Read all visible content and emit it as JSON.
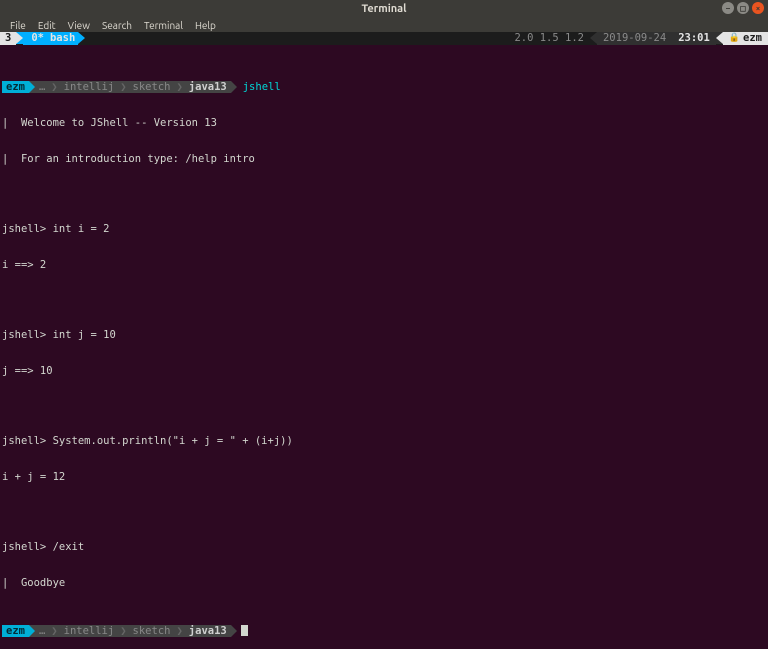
{
  "window": {
    "title": "Terminal"
  },
  "menubar": {
    "file": "File",
    "edit": "Edit",
    "view": "View",
    "search": "Search",
    "terminal": "Terminal",
    "help": "Help"
  },
  "tmux": {
    "session": "3",
    "window_index": "0*",
    "window_name": "bash",
    "load": "2.0 1.5 1.2",
    "date": "2019-09-24",
    "time": "23:01",
    "host": "ezm"
  },
  "prompt1": {
    "user": "ezm",
    "dots": "…",
    "p1": "intellij",
    "p2": "sketch",
    "p3": "java13",
    "cmd": "jshell"
  },
  "session": {
    "welcome1": "|  Welcome to JShell -- Version 13",
    "welcome2": "|  For an introduction type: /help intro",
    "l1": "jshell> int i = 2",
    "l2": "i ==> 2",
    "l3": "jshell> int j = 10",
    "l4": "j ==> 10",
    "l5": "jshell> System.out.println(\"i + j = \" + (i+j))",
    "l6": "i + j = 12",
    "l7": "jshell> /exit",
    "l8": "|  Goodbye"
  },
  "prompt2": {
    "user": "ezm",
    "dots": "…",
    "p1": "intellij",
    "p2": "sketch",
    "p3": "java13"
  }
}
